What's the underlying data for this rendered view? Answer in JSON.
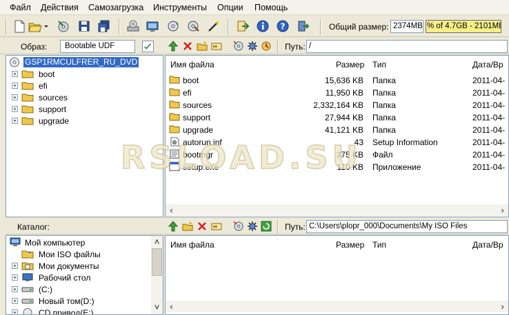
{
  "menu": [
    "Файл",
    "Действия",
    "Самозагрузка",
    "Инструменты",
    "Опции",
    "Помощь"
  ],
  "toolbar": {
    "buttons": [
      "new-icon",
      "open-icon",
      "extract-icon",
      "save-icon",
      "save-as-icon",
      "burn-icon",
      "mount-icon",
      "compress-icon",
      "checksum-icon",
      "wizard-icon",
      "export-icon",
      "info-icon",
      "help-icon",
      "exit-icon"
    ],
    "total_size_label": "Общий размер:",
    "total_size_value": "2374MB",
    "capacity_text": "% of 4.7GB - 2101MB"
  },
  "image_panel": {
    "label": "Образ:",
    "image_type": "Bootable UDF",
    "path_label": "Путь:",
    "path": "/",
    "tree": {
      "root": "GSP1RMCULFRER_RU_DVD",
      "children": [
        "boot",
        "efi",
        "sources",
        "support",
        "upgrade"
      ]
    },
    "columns": [
      "Имя файла",
      "Размер",
      "Тип",
      "Дата/Вр"
    ],
    "files": [
      {
        "name": "boot",
        "size": "15,636 KB",
        "type": "Папка",
        "date": "2011-04-",
        "icon": "folder-icon"
      },
      {
        "name": "efi",
        "size": "11,950 KB",
        "type": "Папка",
        "date": "2011-04-",
        "icon": "folder-icon"
      },
      {
        "name": "sources",
        "size": "2,332,164 KB",
        "type": "Папка",
        "date": "2011-04-",
        "icon": "folder-icon"
      },
      {
        "name": "support",
        "size": "27,944 KB",
        "type": "Папка",
        "date": "2011-04-",
        "icon": "folder-icon"
      },
      {
        "name": "upgrade",
        "size": "41,121 KB",
        "type": "Папка",
        "date": "2011-04-",
        "icon": "folder-icon"
      },
      {
        "name": "autorun.inf",
        "size": "43",
        "type": "Setup Information",
        "date": "2011-04-",
        "icon": "settings-file-icon"
      },
      {
        "name": "bootmgr",
        "size": "375 KB",
        "type": "Файл",
        "date": "2011-04-",
        "icon": "file-icon"
      },
      {
        "name": "setup.exe",
        "size": "110 KB",
        "type": "Приложение",
        "date": "2011-04-",
        "icon": "app-icon"
      }
    ]
  },
  "local_panel": {
    "label": "Каталог:",
    "path_label": "Путь:",
    "path": "C:\\Users\\plopr_000\\Documents\\My ISO Files",
    "tree": {
      "root": "Мой компьютер",
      "children": [
        "Мои ISO файлы",
        "Мои документы",
        "Рабочий стол",
        "(C:)",
        "Новый том(D:)",
        "CD привод(E:)"
      ]
    },
    "columns": [
      "Имя файла",
      "Размер",
      "Тип",
      "Дата/Вр"
    ]
  },
  "watermark": "RSLOAD.SU"
}
